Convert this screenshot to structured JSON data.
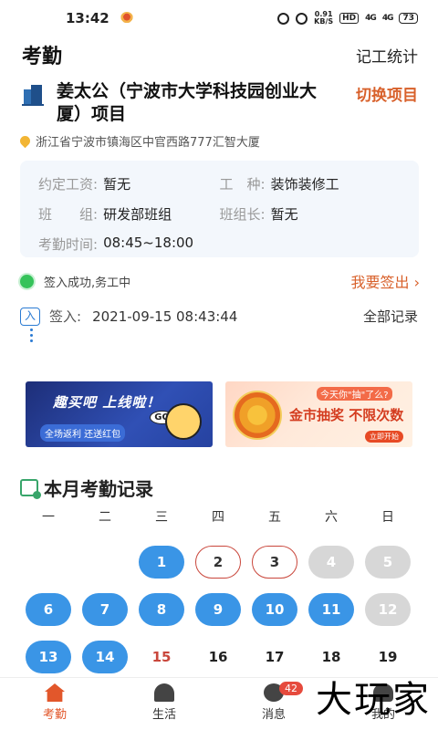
{
  "status_bar": {
    "time": "13:42",
    "net_speed_value": "0.91",
    "net_speed_unit": "KB/S",
    "hd": "HD",
    "signal": "4G",
    "signal2": "4G",
    "battery": "73"
  },
  "header": {
    "title": "考勤",
    "stats_link": "记工统计"
  },
  "project": {
    "name": "姜太公（宁波市大学科技园创业大厦）项目",
    "switch_label": "切换项目",
    "address": "浙江省宁波市镇海区中官西路777汇智大厦"
  },
  "info": {
    "wage_label": "约定工资:",
    "wage_value": "暂无",
    "trade_label": "工　种:",
    "trade_value": "装饰装修工",
    "team_label": "班　　组:",
    "team_value": "研发部班组",
    "leader_label": "班组长:",
    "leader_value": "暂无",
    "hours_label": "考勤时间:",
    "hours_value": "08:45~18:00"
  },
  "sign_status": {
    "text": "签入成功,务工中",
    "sign_out": "我要签出 ›"
  },
  "checkin": {
    "badge": "入",
    "label": "签入:",
    "time": "2021-09-15 08:43:44",
    "all_records": "全部记录"
  },
  "banners": {
    "left": {
      "headline": "趣买吧 上线啦！",
      "sub": "全场返利 还送红包",
      "go": "GO"
    },
    "right": {
      "small": "今天你\"抽\"了么?",
      "headline": "金市抽奖 不限次数",
      "cta": "立即开始"
    }
  },
  "calendar": {
    "title": "本月考勤记录",
    "weekdays": [
      "一",
      "二",
      "三",
      "四",
      "五",
      "六",
      "日"
    ],
    "weeks": [
      [
        {
          "day": "",
          "status": "empty"
        },
        {
          "day": "",
          "status": "empty"
        },
        {
          "day": "1",
          "status": "attended"
        },
        {
          "day": "2",
          "status": "marked"
        },
        {
          "day": "3",
          "status": "marked"
        },
        {
          "day": "4",
          "status": "future"
        },
        {
          "day": "5",
          "status": "future"
        }
      ],
      [
        {
          "day": "6",
          "status": "attended"
        },
        {
          "day": "7",
          "status": "attended"
        },
        {
          "day": "8",
          "status": "attended"
        },
        {
          "day": "9",
          "status": "attended"
        },
        {
          "day": "10",
          "status": "attended"
        },
        {
          "day": "11",
          "status": "attended"
        },
        {
          "day": "12",
          "status": "future"
        }
      ],
      [
        {
          "day": "13",
          "status": "attended"
        },
        {
          "day": "14",
          "status": "attended"
        },
        {
          "day": "15",
          "status": "today"
        },
        {
          "day": "16",
          "status": "plain"
        },
        {
          "day": "17",
          "status": "plain"
        },
        {
          "day": "18",
          "status": "plain"
        },
        {
          "day": "19",
          "status": "plain"
        }
      ]
    ]
  },
  "tabbar": {
    "items": [
      {
        "label": "考勤",
        "icon": "home-icon",
        "active": true
      },
      {
        "label": "生活",
        "icon": "helmet-icon",
        "active": false
      },
      {
        "label": "消息",
        "icon": "message-icon",
        "active": false,
        "badge": "42"
      },
      {
        "label": "我的",
        "icon": "profile-icon",
        "active": false
      }
    ]
  },
  "watermark": "大玩家",
  "colors": {
    "accent": "#e2572b",
    "attended": "#3a95e6",
    "marked_border": "#c9463b",
    "future": "#d7d7d7"
  }
}
